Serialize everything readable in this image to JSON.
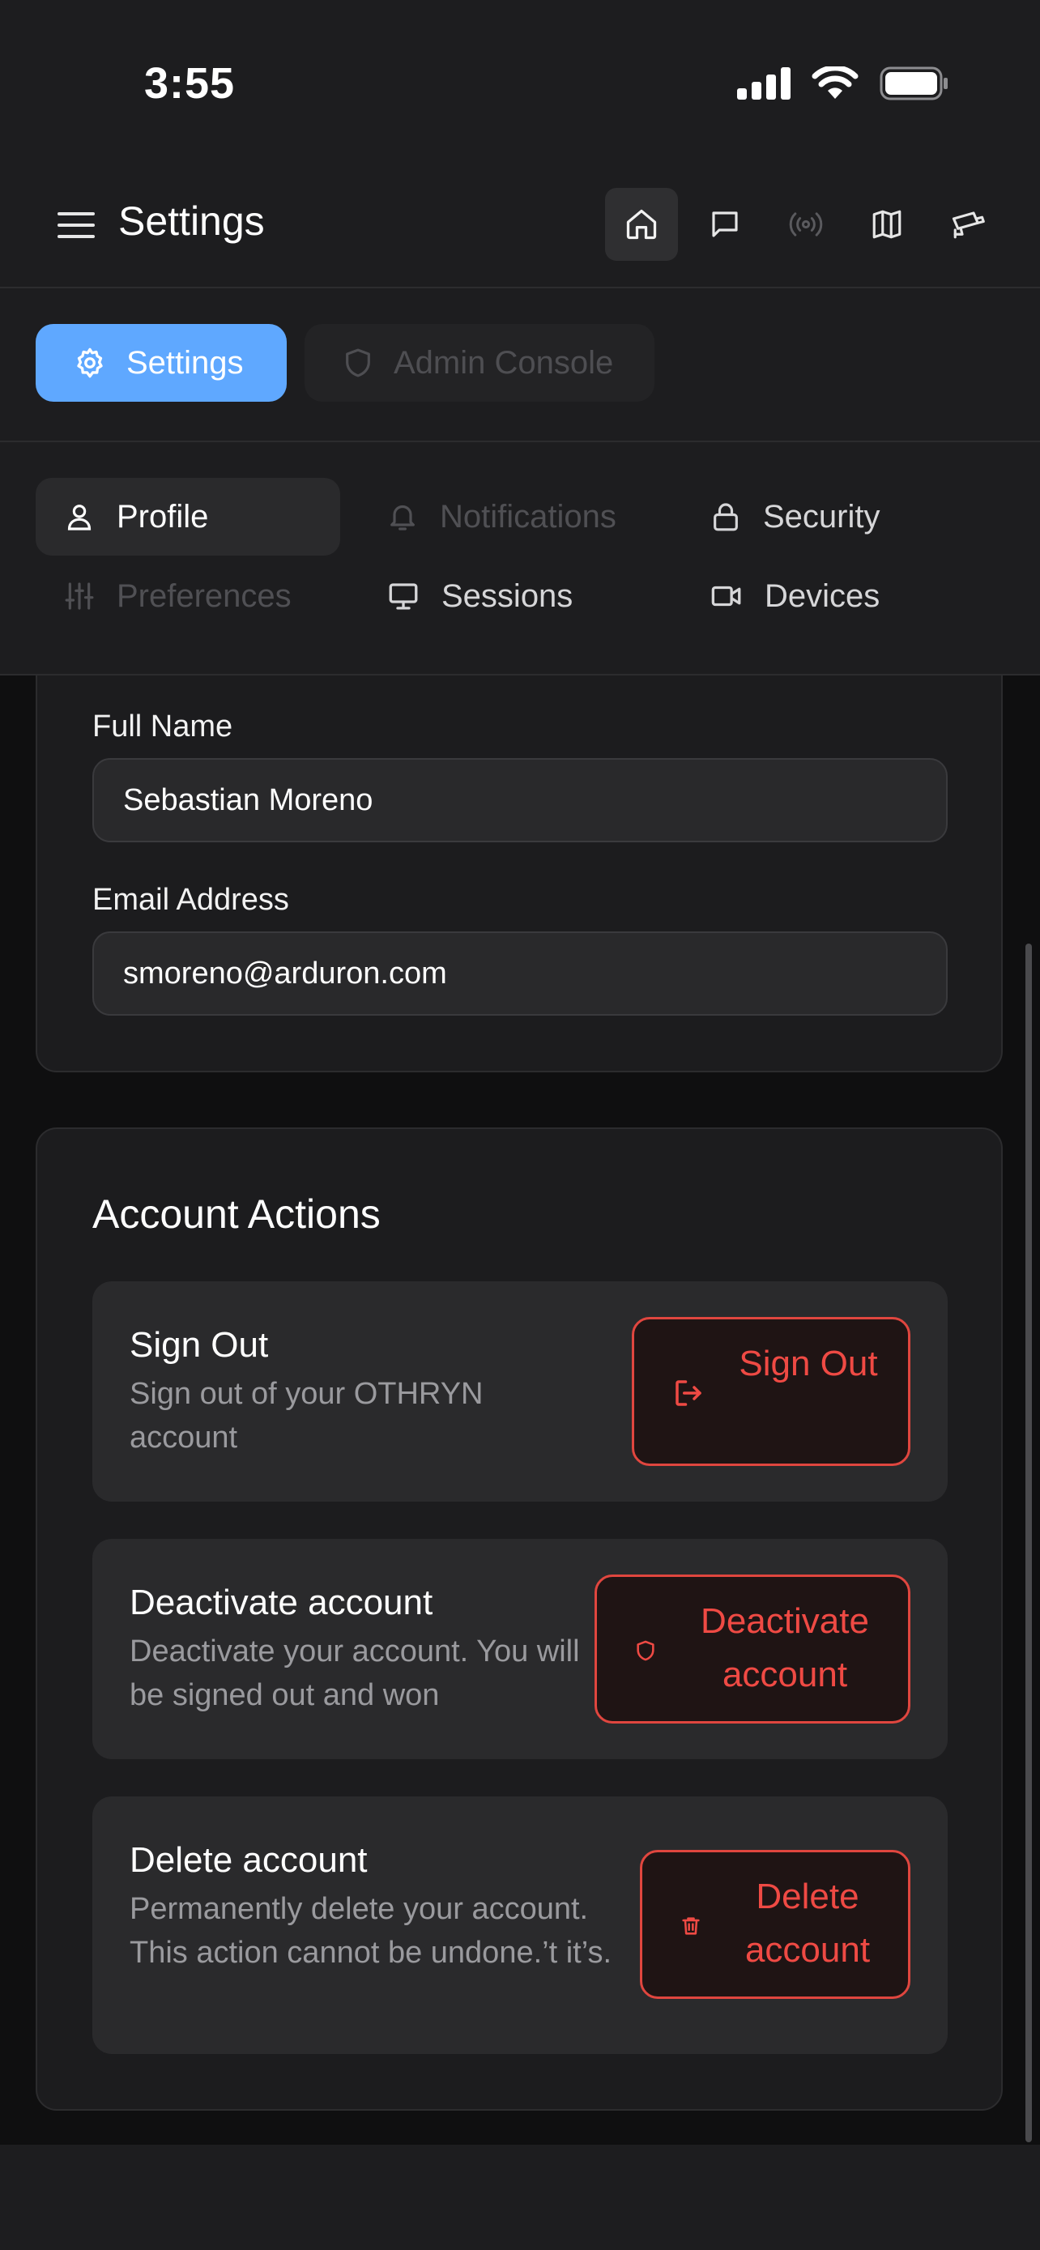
{
  "status_bar": {
    "time": "3:55"
  },
  "header": {
    "title": "Settings",
    "icons": [
      "home-icon",
      "chat-icon",
      "broadcast-icon",
      "map-icon",
      "camera-icon"
    ]
  },
  "top_tabs": [
    {
      "label": "Settings",
      "icon": "gear-icon",
      "active": true
    },
    {
      "label": "Admin Console",
      "icon": "shield-icon",
      "active": false
    }
  ],
  "sub_tabs": [
    {
      "label": "Profile",
      "icon": "user-icon",
      "active": true
    },
    {
      "label": "Notifications",
      "icon": "bell-icon",
      "active": false
    },
    {
      "label": "Security",
      "icon": "lock-icon",
      "active": false
    },
    {
      "label": "Preferences",
      "icon": "sliders-icon",
      "active": false
    },
    {
      "label": "Sessions",
      "icon": "monitor-icon",
      "active": false
    },
    {
      "label": "Devices",
      "icon": "video-icon",
      "active": false
    }
  ],
  "profile": {
    "full_name_label": "Full Name",
    "full_name_value": "Sebastian Moreno",
    "email_label": "Email Address",
    "email_value": "smoreno@arduron.com"
  },
  "account_actions": {
    "title": "Account Actions",
    "items": [
      {
        "title": "Sign Out",
        "description": "Sign out of your OTHRYN account",
        "button_label": "Sign Out",
        "button_icon": "sign-out-icon"
      },
      {
        "title": "Deactivate account",
        "description": "Deactivate your account. You will be signed out and won",
        "button_label": "Deactivate account",
        "button_icon": "shield-icon"
      },
      {
        "title": "Delete account",
        "description": "Permanently delete your account. This action cannot be undone.’t it’s.",
        "button_label": "Delete account",
        "button_icon": "trash-icon"
      }
    ]
  },
  "colors": {
    "accent": "#5fa8ff",
    "danger": "#ef4a44",
    "background": "#0f0f10",
    "surface": "#1c1c1e"
  }
}
